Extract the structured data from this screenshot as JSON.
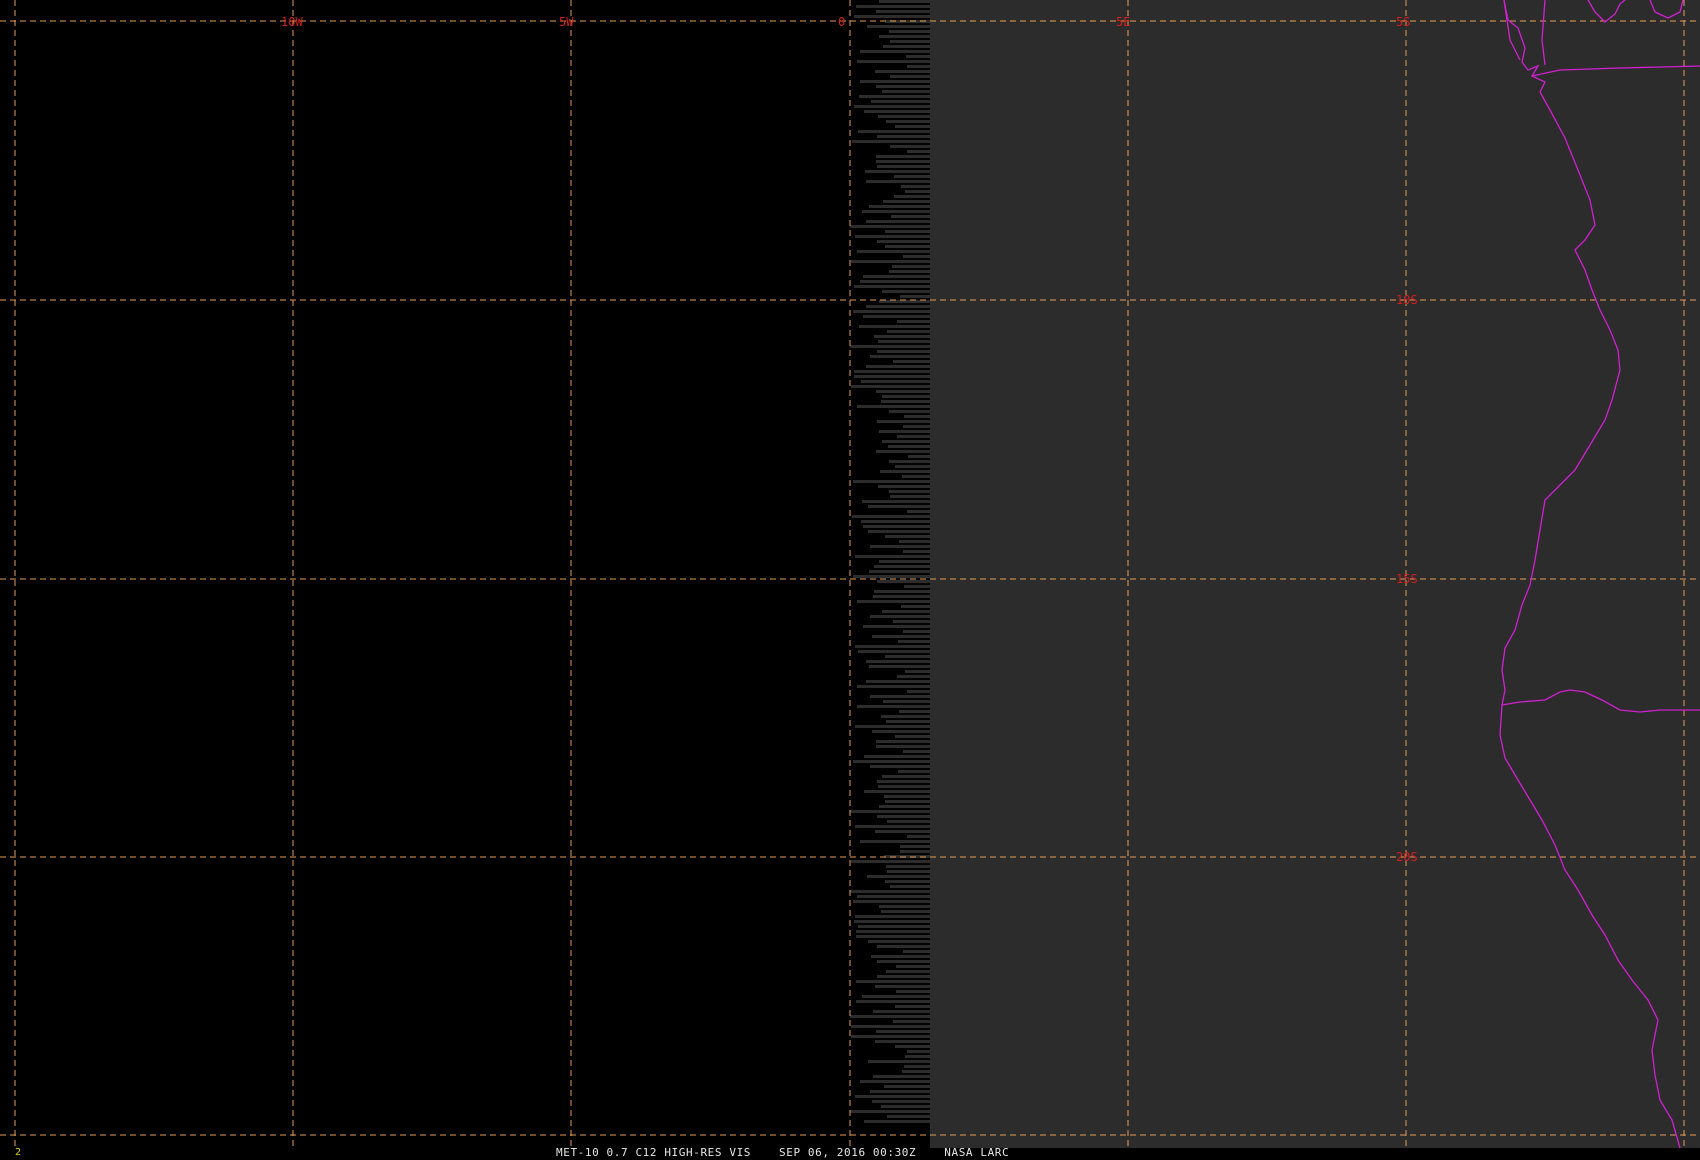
{
  "image": {
    "background_color": "#000000",
    "satellite_data_color": "#2c2c2c",
    "grid_line_color": "#e59b5a",
    "grid_label_color": "#d02020",
    "coastline_color": "#d020d0"
  },
  "grid": {
    "longitude_labels": [
      "10W",
      "5W",
      "0",
      "5E"
    ],
    "latitude_labels": [
      "5S",
      "10S",
      "15S",
      "20S"
    ]
  },
  "footer": {
    "frame_number": "2",
    "product": "MET-10 0.7 C12 HIGH-RES VIS",
    "datetime": "SEP 06, 2016 00:30Z",
    "source": "NASA LARC"
  },
  "icons": [
    "coastline-overlay",
    "latlon-grid"
  ]
}
